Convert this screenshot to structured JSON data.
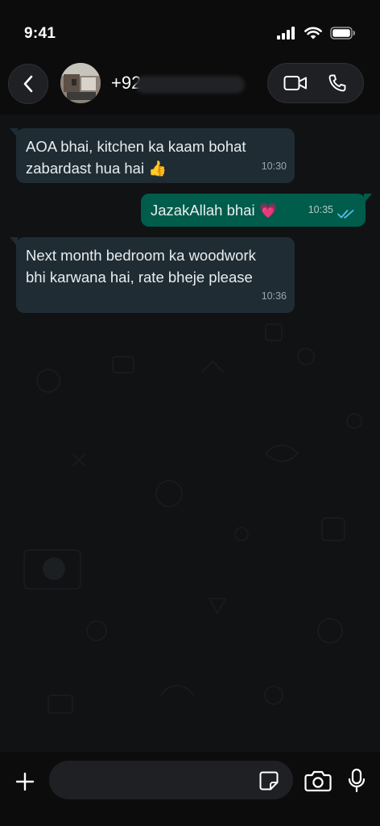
{
  "status_bar": {
    "time": "9:41"
  },
  "header": {
    "contact_name": "+92",
    "icons": [
      "back-chevron",
      "video-camera",
      "phone"
    ]
  },
  "messages": [
    {
      "direction": "incoming",
      "text": "AOA bhai, kitchen ka kaam bohat\nzabardast hua hai 👍",
      "time": "10:30"
    },
    {
      "direction": "outgoing",
      "text": "JazakAllah bhai 💗",
      "time": "10:35",
      "status": "read"
    },
    {
      "direction": "incoming",
      "text": "Next month bedroom ka woodwork\nbhi karwana hai, rate bheje please",
      "time": "10:36"
    }
  ],
  "input_bar": {
    "placeholder": "",
    "icons": [
      "plus",
      "sticker",
      "camera",
      "microphone"
    ]
  },
  "colors": {
    "incoming_bubble": "#1f2c34",
    "outgoing_bubble": "#005c4b",
    "read_ticks": "#53bdeb",
    "background": "#101214"
  }
}
